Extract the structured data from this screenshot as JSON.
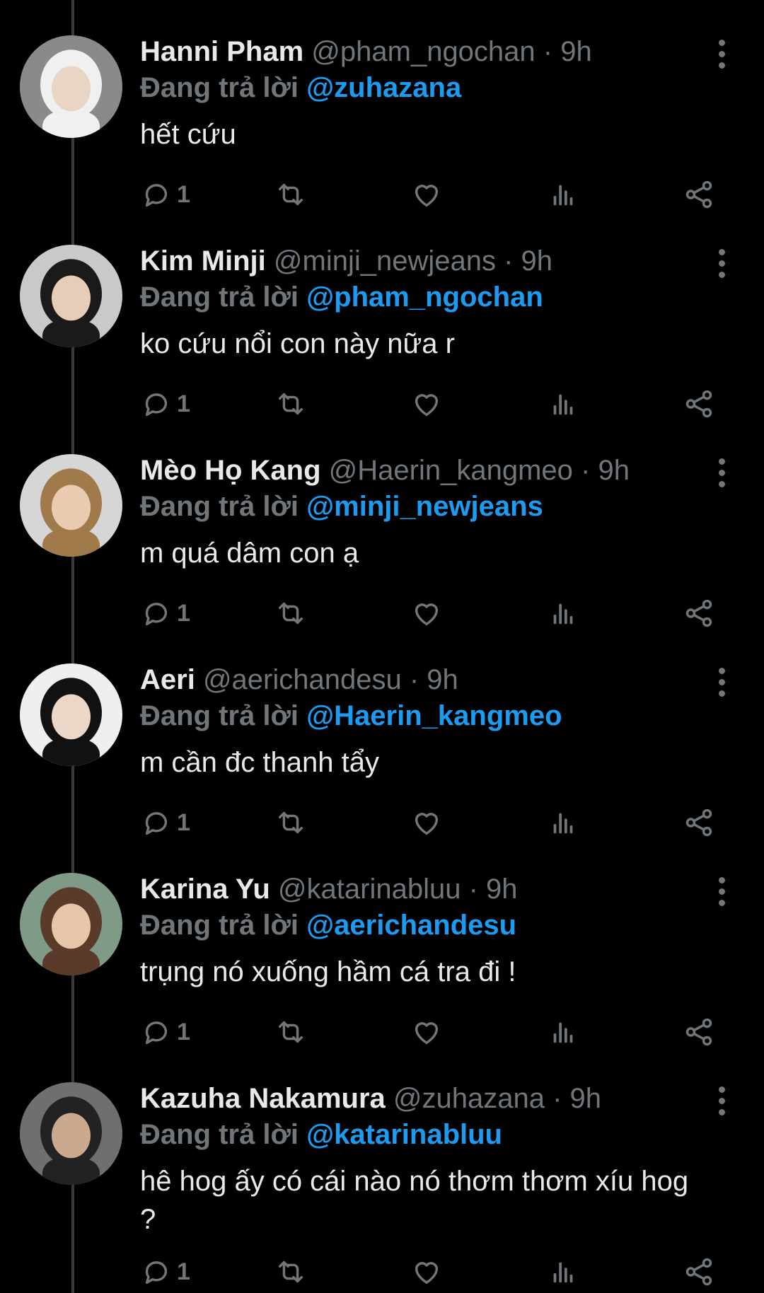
{
  "tweets": [
    {
      "name": "Hanni Pham",
      "meta": "@pham_ngochan · 9h",
      "reply_lead": "Đang trả lời",
      "reply_to": "@zuhazana",
      "text": "hết cứu",
      "reply_count": "1",
      "avatar_colors": {
        "bg": "#8a8a8a",
        "face": "#e8d5c4",
        "hair": "#f0f0f0"
      }
    },
    {
      "name": "Kim Minji",
      "meta": "@minji_newjeans · 9h",
      "reply_lead": "Đang trả lời",
      "reply_to": "@pham_ngochan",
      "text": "ko cứu nổi con này nữa r",
      "reply_count": "1",
      "avatar_colors": {
        "bg": "#c9c9c9",
        "face": "#e6cdb8",
        "hair": "#1a1a1a"
      }
    },
    {
      "name": "Mèo Họ Kang",
      "meta": "@Haerin_kangmeo · 9h",
      "reply_lead": "Đang trả lời",
      "reply_to": "@minji_newjeans",
      "text": "m quá dâm con ạ",
      "reply_count": "1",
      "avatar_colors": {
        "bg": "#d6d6d6",
        "face": "#e8cbb0",
        "hair": "#a07a4a"
      }
    },
    {
      "name": "Aeri",
      "meta": "@aerichandesu · 9h",
      "reply_lead": "Đang trả lời",
      "reply_to": "@Haerin_kangmeo",
      "text": "m cần đc thanh tẩy",
      "reply_count": "1",
      "avatar_colors": {
        "bg": "#efefef",
        "face": "#ead7c8",
        "hair": "#111111"
      }
    },
    {
      "name": "Karina Yu",
      "meta": "@katarinabluu · 9h",
      "reply_lead": "Đang trả lời",
      "reply_to": "@aerichandesu",
      "text": "trụng nó xuống hầm cá tra đi !",
      "reply_count": "1",
      "avatar_colors": {
        "bg": "#7f9a86",
        "face": "#e5c6a8",
        "hair": "#5a3b2a"
      }
    },
    {
      "name": "Kazuha Nakamura",
      "meta": "@zuhazana · 9h",
      "reply_lead": "Đang trả lời",
      "reply_to": "@katarinabluu",
      "text": "hê hog ấy có cái nào nó thơm thơm xíu hog ?",
      "reply_count": "1",
      "avatar_colors": {
        "bg": "#6f6f6f",
        "face": "#caa98f",
        "hair": "#222222"
      }
    }
  ],
  "icons": {
    "reply": "reply-icon",
    "retweet": "retweet-icon",
    "like": "heart-icon",
    "views": "views-icon",
    "share": "share-icon",
    "more": "more-icon"
  },
  "colors": {
    "background": "#000000",
    "text": "#e7e9ea",
    "muted": "#71767b",
    "accent": "#1d9bf0"
  }
}
